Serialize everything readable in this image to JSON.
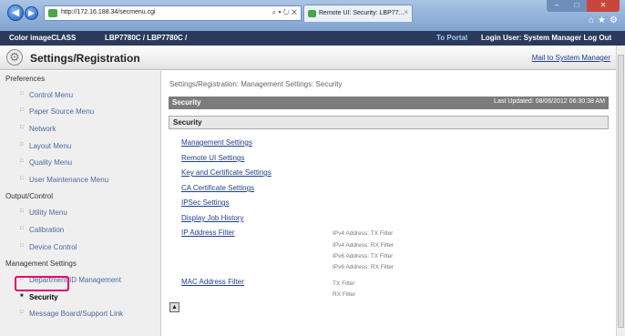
{
  "browser": {
    "url": "http://172.16.188.34/secmenu.cgi",
    "address_tools": "⌕ ▾ ↻ ✕",
    "tab_title": "Remote UI: Security: LBP77...",
    "tab_close": "×",
    "window_controls": {
      "minimize": "–",
      "maximize": "□",
      "close": "✕"
    },
    "right_icons": "⌂★⚙"
  },
  "device": {
    "name": "Color imageCLASS",
    "model": "LBP7780C / LBP7780C /",
    "portal_link": "To Portal",
    "login_user": "Login User: System Manager Log Out"
  },
  "header": {
    "title": "Settings/Registration",
    "mail_link": "Mail to System Manager"
  },
  "sidebar": {
    "groups": [
      {
        "heading": "Preferences",
        "items": [
          "Control Menu",
          "Paper Source Menu",
          "Network",
          "Layout Menu",
          "Quality Menu",
          "User Maintenance Menu"
        ]
      },
      {
        "heading": "Output/Control",
        "items": [
          "Utility Menu",
          "Calibration",
          "Device Control"
        ]
      },
      {
        "heading": "Management Settings",
        "items": [
          "Department ID Management",
          "Security",
          "Message Board/Support Link"
        ]
      }
    ],
    "active_item": "Security"
  },
  "main": {
    "breadcrumb": "Settings/Registration: Management Settings: Security",
    "section_title": "Security",
    "last_updated": "Last Updated: 08/06/2012 06:30:38 AM",
    "subsection_title": "Security",
    "links": [
      "Management Settings",
      "Remote UI Settings",
      "Key and Certificate Settings",
      "CA Certificate Settings",
      "IPSec Settings",
      "Display Job History",
      "IP Address Filter",
      "MAC Address Filter"
    ],
    "ip_filters": [
      "IPv4 Address: TX Filter",
      "IPv4 Address: RX Filter",
      "IPv6 Address: TX Filter",
      "IPv6 Address: RX Filter"
    ],
    "mac_filters": [
      "TX Filter",
      "RX Filter"
    ],
    "top_button": "▲"
  },
  "colors": {
    "device_bar": "#2b3a5c",
    "section_bar": "#7c7c7c",
    "link": "#1e3f8f",
    "highlight": "#e3006d"
  }
}
